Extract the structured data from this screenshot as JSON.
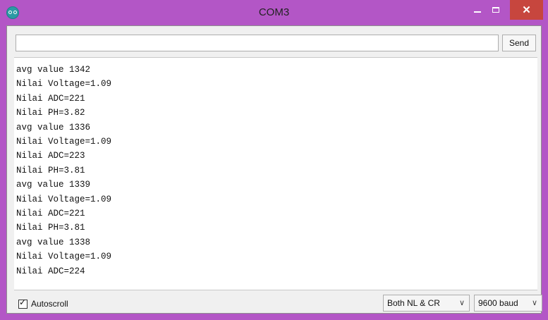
{
  "window": {
    "title": "COM3"
  },
  "toolbar": {
    "input_value": "",
    "send_label": "Send"
  },
  "output": {
    "lines": [
      "avg value 1342",
      "Nilai Voltage=1.09",
      "Nilai ADC=221",
      "Nilai PH=3.82",
      "avg value 1336",
      "Nilai Voltage=1.09",
      "Nilai ADC=223",
      "Nilai PH=3.81",
      "avg value 1339",
      "Nilai Voltage=1.09",
      "Nilai ADC=221",
      "Nilai PH=3.81",
      "avg value 1338",
      "Nilai Voltage=1.09",
      "Nilai ADC=224"
    ]
  },
  "footer": {
    "autoscroll_label": "Autoscroll",
    "autoscroll_checked": true,
    "line_ending": "Both NL & CR",
    "baud_rate": "9600 baud"
  },
  "icons": {
    "app": "arduino-icon",
    "minimize": "minimize-icon",
    "maximize": "maximize-icon",
    "close": "close-icon",
    "dropdown": "chevron-down-icon"
  },
  "colors": {
    "titlebar": "#b356c6",
    "close_button": "#c7463e"
  }
}
